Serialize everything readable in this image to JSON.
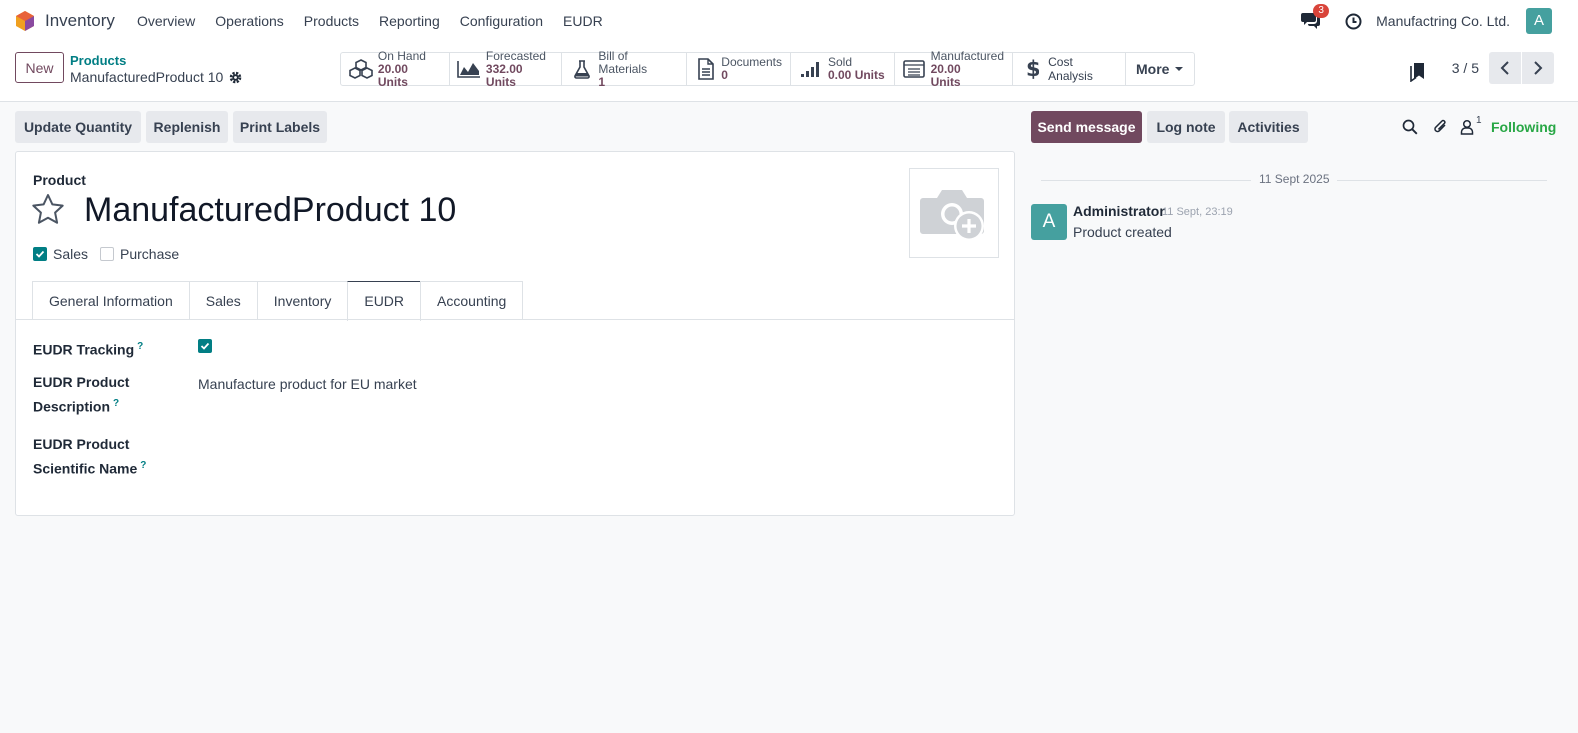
{
  "app": {
    "name": "Inventory"
  },
  "menu": [
    "Overview",
    "Operations",
    "Products",
    "Reporting",
    "Configuration",
    "EUDR"
  ],
  "systray": {
    "messages_count": "3",
    "company": "Manufactring Co. Ltd.",
    "user_initial": "A"
  },
  "control": {
    "new_label": "New",
    "breadcrumb_parent": "Products",
    "breadcrumb_current": "ManufacturedProduct 10",
    "pager": "3 / 5"
  },
  "smart_buttons": [
    {
      "label": "On Hand",
      "value": "20.00 Units",
      "icon": "cubes-icon"
    },
    {
      "label": "Forecasted",
      "value": "332.00 Units",
      "icon": "area-chart-icon"
    },
    {
      "label": "Bill of Materials",
      "value": "1",
      "icon": "flask-icon"
    },
    {
      "label": "Documents",
      "value": "0",
      "icon": "document-icon"
    },
    {
      "label": "Sold",
      "value": "0.00 Units",
      "icon": "signal-icon"
    },
    {
      "label": "Manufactured",
      "value": "20.00",
      "value2": "Units",
      "icon": "list-alt-icon"
    },
    {
      "label": "Cost Analysis",
      "icon": "dollar-icon"
    }
  ],
  "more_label": "More",
  "actions": [
    "Update Quantity",
    "Replenish",
    "Print Labels"
  ],
  "form": {
    "product_label": "Product",
    "product_name": "ManufacturedProduct 10",
    "sales_label": "Sales",
    "sales_checked": true,
    "purchase_label": "Purchase",
    "purchase_checked": false,
    "tabs": [
      "General Information",
      "Sales",
      "Inventory",
      "EUDR",
      "Accounting"
    ],
    "active_tab": "EUDR",
    "eudr": {
      "tracking_label": "EUDR Tracking",
      "tracking_checked": true,
      "desc_label_1": "EUDR Product",
      "desc_label_2": "Description",
      "desc_value": "Manufacture product for EU market",
      "sci_label_1": "EUDR Product",
      "sci_label_2": "Scientific Name",
      "help": "?"
    }
  },
  "chatter": {
    "send_message": "Send message",
    "log_note": "Log note",
    "activities": "Activities",
    "followers_count": "1",
    "following": "Following",
    "date": "11 Sept 2025",
    "messages": [
      {
        "author": "Administrator",
        "time": "11 Sept, 23:19",
        "body": "Product created",
        "initial": "A"
      }
    ]
  },
  "colors": {
    "brand": "#71495f",
    "accent": "#017e84",
    "avatar": "#45a09f",
    "following": "#28a745",
    "badge": "#d9443a"
  }
}
